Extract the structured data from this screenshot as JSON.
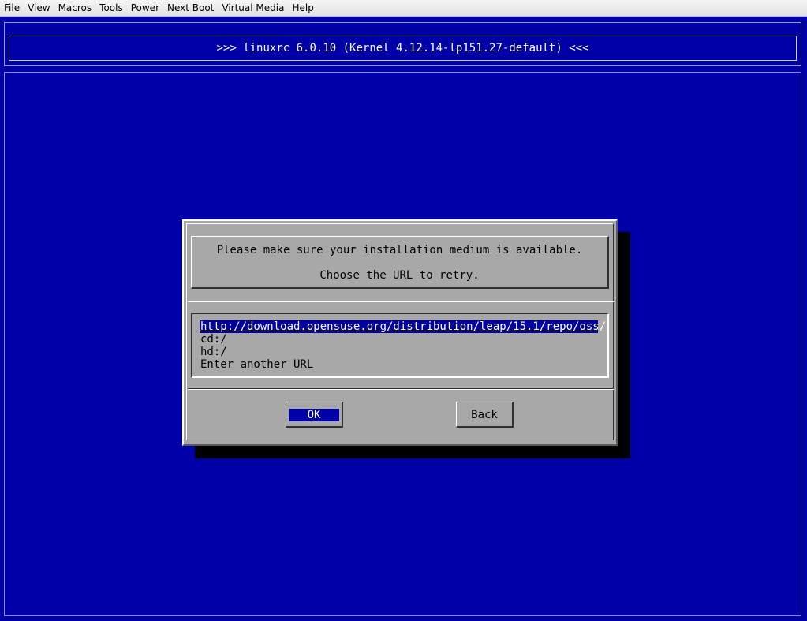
{
  "menubar": {
    "items": [
      "File",
      "View",
      "Macros",
      "Tools",
      "Power",
      "Next Boot",
      "Virtual Media",
      "Help"
    ]
  },
  "console": {
    "title": ">>> linuxrc 6.0.10 (Kernel 4.12.14-lp151.27-default) <<<",
    "background_color": "#0000a8",
    "dialog": {
      "message_line1": "Please make sure your installation medium is available.",
      "message_line2": "Choose the URL to retry.",
      "options": [
        "http://download.opensuse.org/distribution/leap/15.1/repo/oss/",
        "cd:/",
        "hd:/",
        "Enter another URL"
      ],
      "selected_index": 0,
      "ok_label": "OK",
      "back_label": "Back"
    }
  }
}
